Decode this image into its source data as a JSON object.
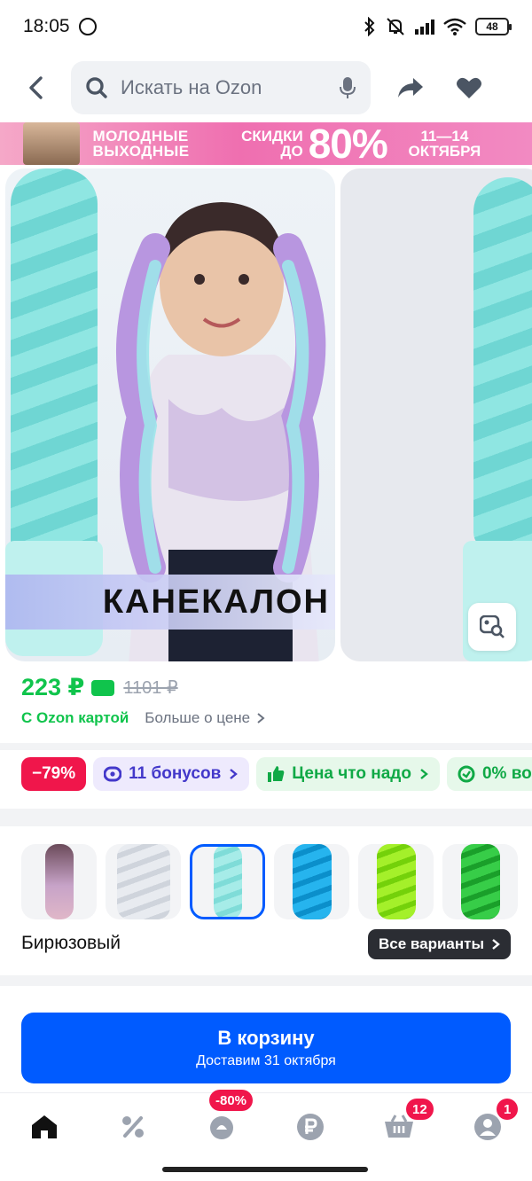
{
  "status": {
    "time": "18:05",
    "battery": "48"
  },
  "header": {
    "search_placeholder": "Искать на Ozon"
  },
  "banner": {
    "line1": "МОЛОДНЫЕ ВЫХОДНЫЕ",
    "line2": "СКИДКИ ДО",
    "percent": "80%",
    "dates": "11—14 ОКТЯБРЯ"
  },
  "gallery": {
    "overlay_text": "КАНЕКАЛОН"
  },
  "price": {
    "current": "223 ₽",
    "old": "1101 ₽",
    "card_label": "С Ozon картой",
    "more_label": "Больше о цене"
  },
  "chips": {
    "discount": "−79%",
    "bonus": "11 бонусов",
    "good_price": "Цена что надо",
    "installment": "0% во"
  },
  "variants": {
    "selected_index": 2,
    "colors": [
      "#b78ab5",
      "#dfe3ea",
      "#8fe6e2",
      "#1fa8e6",
      "#8fea12",
      "#28c238"
    ],
    "color_name": "Бирюзовый",
    "all_label": "Все варианты"
  },
  "cart": {
    "label": "В корзину",
    "delivery": "Доставим 31 октября"
  },
  "nav": {
    "badges": {
      "promo": "-80%",
      "cart": "12",
      "profile": "1"
    }
  },
  "colors": {
    "accent": "#005bff",
    "green": "#10c44c",
    "red": "#f0164b"
  }
}
